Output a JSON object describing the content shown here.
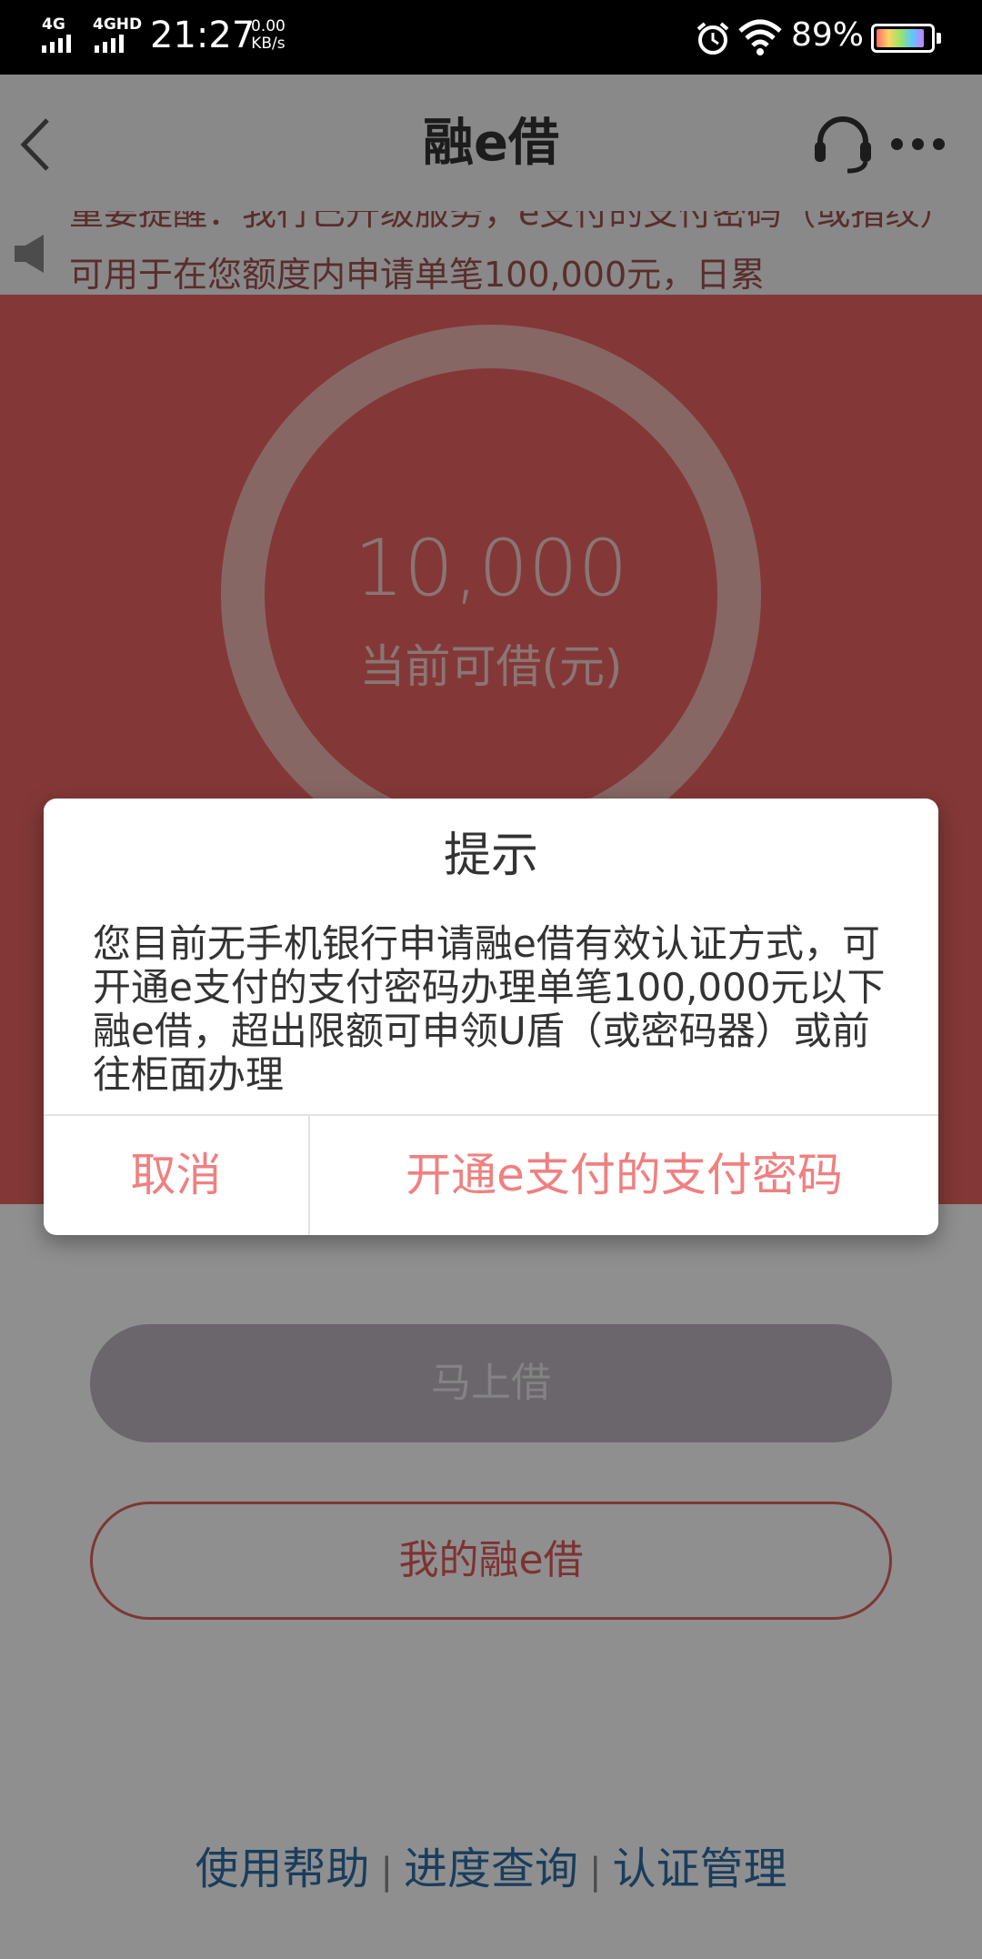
{
  "status_bar": {
    "network1": "4G",
    "network2": "4GHD",
    "time": "21:27",
    "speed_value": "0.00",
    "speed_unit": "KB/s",
    "battery_percent": "89%",
    "battery_level": 0.89,
    "icons": [
      "signal-icon",
      "alarm-icon",
      "wifi-icon",
      "battery-icon"
    ]
  },
  "nav": {
    "title": "融e借",
    "icons": [
      "back-icon",
      "customer-service-icon",
      "more-icon"
    ]
  },
  "notice": {
    "text": "重要提醒：我行已升级服务，e支付的支付密码（或指纹）可用于在您额度内申请单笔100,000元，日累",
    "icon": "speaker-icon"
  },
  "hero": {
    "amount": "10,000",
    "label": "当前可借(元)"
  },
  "buttons": {
    "borrow": "马上借",
    "my_loan": "我的融e借"
  },
  "footer": {
    "help": "使用帮助",
    "separator": "|",
    "progress": "进度查询",
    "auth": "认证管理"
  },
  "dialog": {
    "title": "提示",
    "message": "您目前无手机银行申请融e借有效认证方式，可开通e支付的支付密码办理单笔100,000元以下融e借，超出限额可申领U盾（或密码器）或前往柜面办理",
    "cancel": "取消",
    "confirm": "开通e支付的支付密码"
  },
  "colors": {
    "hero_red": "#ea6462",
    "accent_red": "#e05a5a",
    "link_blue": "#2f6ea4"
  }
}
